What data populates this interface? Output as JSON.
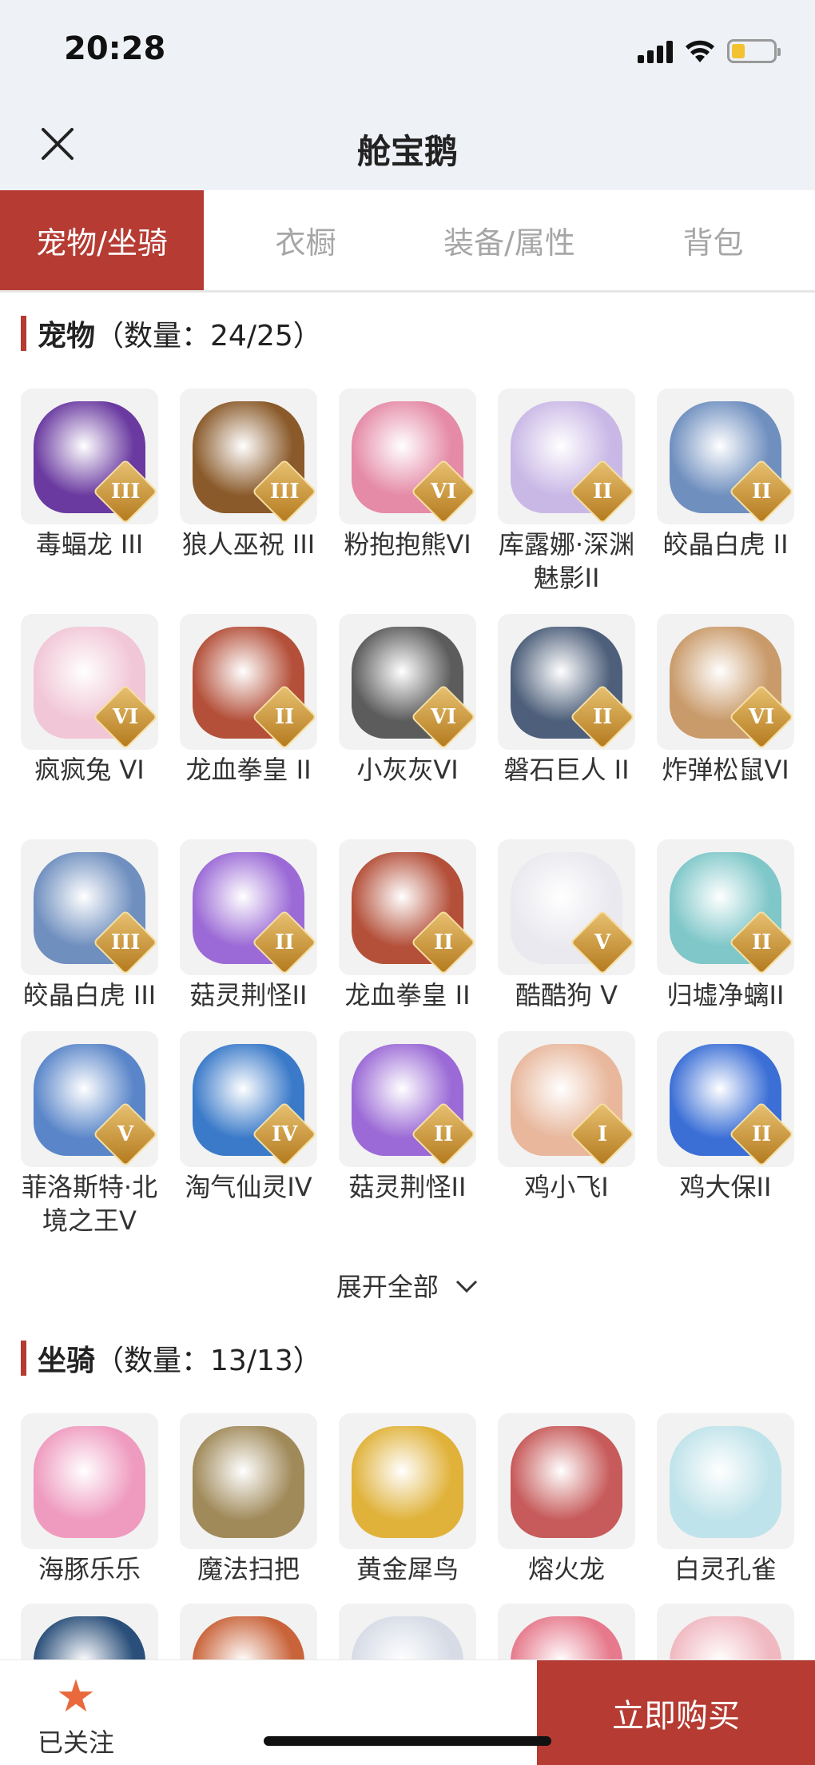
{
  "status": {
    "time": "20:28"
  },
  "nav": {
    "title": "舱宝鹅"
  },
  "tabs": [
    {
      "label": "宠物/坐骑",
      "active": true
    },
    {
      "label": "衣橱",
      "active": false
    },
    {
      "label": "装备/属性",
      "active": false
    },
    {
      "label": "背包",
      "active": false
    }
  ],
  "pets": {
    "title": "宠物",
    "count_text": "（数量：24/25）",
    "items": [
      {
        "name": "毒蝠龙 III",
        "grade": "III",
        "color": "#6a3aa0"
      },
      {
        "name": "狼人巫祝 III",
        "grade": "III",
        "color": "#8a5a2a"
      },
      {
        "name": "粉抱抱熊VI",
        "grade": "VI",
        "color": "#e58aa7"
      },
      {
        "name": "库露娜·深渊魅影II",
        "grade": "II",
        "color": "#c9b8e6"
      },
      {
        "name": "皎晶白虎 II",
        "grade": "II",
        "color": "#6f8fbf"
      },
      {
        "name": "疯疯兔 VI",
        "grade": "VI",
        "color": "#f1c6d6"
      },
      {
        "name": "龙血拳皇 II",
        "grade": "II",
        "color": "#b4503a"
      },
      {
        "name": "小灰灰VI",
        "grade": "VI",
        "color": "#5c5c5c"
      },
      {
        "name": "磐石巨人 II",
        "grade": "II",
        "color": "#4d5f7a"
      },
      {
        "name": "炸弹松鼠VI",
        "grade": "VI",
        "color": "#c99a6a"
      },
      {
        "name": "皎晶白虎 III",
        "grade": "III",
        "color": "#6f8fbf"
      },
      {
        "name": "菇灵荆怪II",
        "grade": "II",
        "color": "#9b6ad6"
      },
      {
        "name": "龙血拳皇 II",
        "grade": "II",
        "color": "#b4503a"
      },
      {
        "name": "酷酷狗 V",
        "grade": "V",
        "color": "#e9e9ef"
      },
      {
        "name": "归墟净螭II",
        "grade": "II",
        "color": "#7fc7c9"
      },
      {
        "name": "菲洛斯特·北境之王V",
        "grade": "V",
        "color": "#5a86c9"
      },
      {
        "name": "淘气仙灵IV",
        "grade": "IV",
        "color": "#3a7ac9"
      },
      {
        "name": "菇灵荆怪II",
        "grade": "II",
        "color": "#9b6ad6"
      },
      {
        "name": "鸡小飞I",
        "grade": "I",
        "color": "#e8b79c"
      },
      {
        "name": "鸡大保II",
        "grade": "II",
        "color": "#3b6fd6"
      }
    ],
    "expand_label": "展开全部"
  },
  "mounts": {
    "title": "坐骑",
    "count_text": "（数量：13/13）",
    "items": [
      {
        "name": "海豚乐乐",
        "color": "#ef9bbf"
      },
      {
        "name": "魔法扫把",
        "color": "#a08a5a"
      },
      {
        "name": "黄金犀鸟",
        "color": "#e0b23a"
      },
      {
        "name": "熔火龙",
        "color": "#c75a5a"
      },
      {
        "name": "白灵孔雀",
        "color": "#bfe3ea"
      }
    ],
    "partial_colors": [
      "#2a4f7a",
      "#c9643a",
      "#d6dbe6",
      "#e67a8c",
      "#f0b8c0"
    ]
  },
  "bottom": {
    "follow_label": "已关注",
    "buy_label": "立即购买"
  },
  "icons": {
    "close": "close-icon",
    "star": "star-icon",
    "chevron": "chevron-down-icon"
  }
}
